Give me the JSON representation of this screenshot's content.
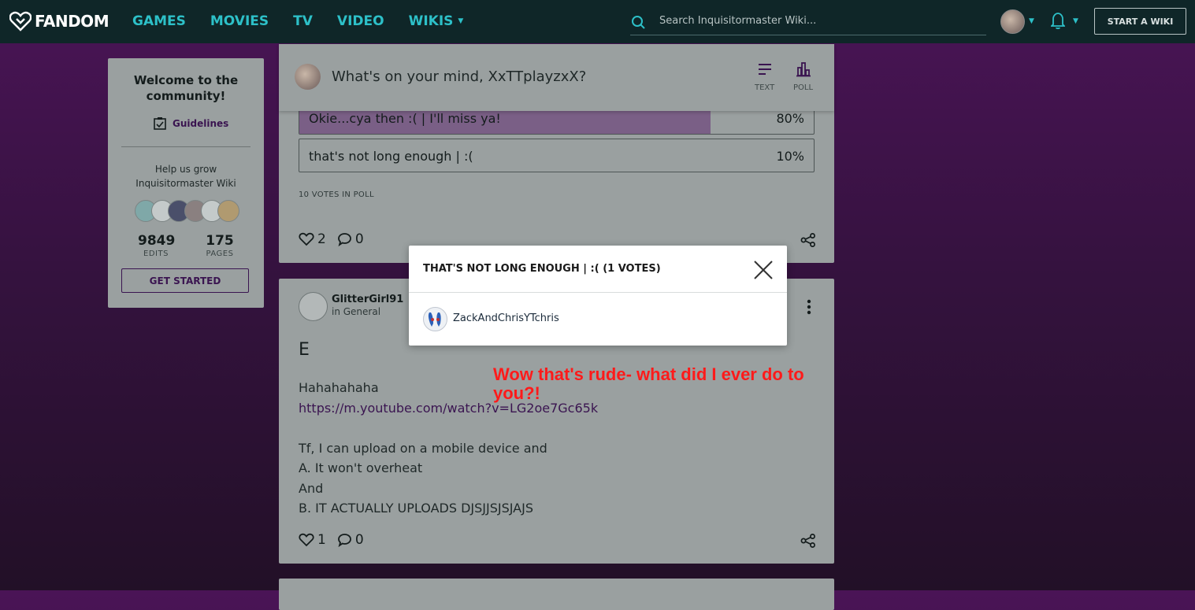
{
  "nav": {
    "logo": "FANDOM",
    "links": [
      "GAMES",
      "MOVIES",
      "TV",
      "VIDEO",
      "WIKIS"
    ],
    "search_placeholder": "Search Inquisitormaster Wiki...",
    "start_wiki": "START A WIKI"
  },
  "rail": {
    "welcome": "Welcome to the community!",
    "guidelines": "Guidelines",
    "help_line1": "Help us grow",
    "help_line2": "Inquisitormaster Wiki",
    "edits_num": "9849",
    "edits_label": "EDITS",
    "pages_num": "175",
    "pages_label": "PAGES",
    "get_started": "GET STARTED"
  },
  "composer": {
    "prompt": "What's on your mind, XxTTplayzxX?",
    "text_label": "TEXT",
    "poll_label": "POLL"
  },
  "poll_post": {
    "options": [
      {
        "text": "Okie...cya then :( | I'll miss ya!",
        "pct": "80%",
        "fraction": 0.8
      },
      {
        "text": "that's not long enough | :(",
        "pct": "10%",
        "fraction": 0.1
      }
    ],
    "votes": "10 VOTES IN POLL",
    "likes": "2",
    "comments": "0"
  },
  "post2": {
    "author": "GlitterGirl91",
    "category": "in General",
    "title": "E",
    "line1": "Hahahahaha",
    "link": "https://m.youtube.com/watch?v=LG2oe7Gc65k",
    "line3": "Tf, I can upload on a mobile device and",
    "line4": "A. It won't overheat",
    "line5": "And",
    "line6": "B. IT ACTUALLY UPLOADS DJSJJSJSJAJS",
    "likes": "1",
    "comments": "0"
  },
  "modal": {
    "title": "THAT'S NOT LONG ENOUGH | :( (1 VOTES)",
    "voter": "ZackAndChrisYTchris"
  },
  "annotation": "Wow that's rude- what did I ever do to you?!",
  "colors": {
    "nav_bg": "#0f2628",
    "nav_link": "#2dc0c8",
    "accent": "#3a1450",
    "annotation": "#ff1a1a"
  }
}
